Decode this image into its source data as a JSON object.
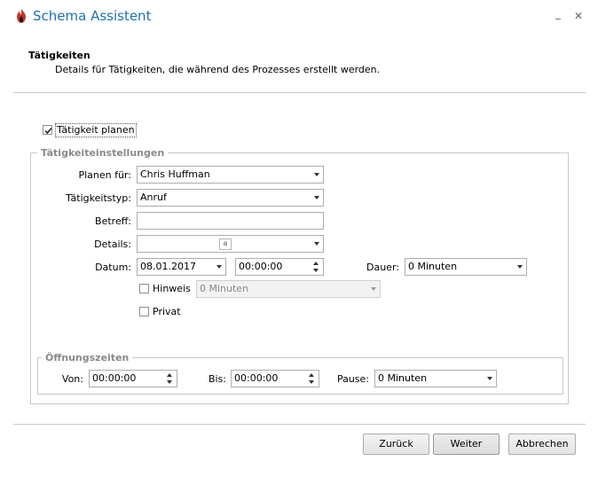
{
  "window": {
    "title": "Schema Assistent",
    "minimize_glyph": "_",
    "close_glyph": "✕",
    "logo_icon": "flame-logo-icon",
    "accent_color": "#1f6fb2"
  },
  "header": {
    "title": "Tätigkeiten",
    "subtitle": "Details für Tätigkeiten, die während des Prozesses erstellt werden."
  },
  "plan_checkbox": {
    "label": "Tätigkeit planen",
    "checked": true
  },
  "settings": {
    "legend": "Tätigkeiteinstellungen",
    "planen_fuer": {
      "label": "Planen für:",
      "value": "Chris Huffman"
    },
    "taetigkeitstyp": {
      "label": "Tätigkeitstyp:",
      "value": "Anruf"
    },
    "betreff": {
      "label": "Betreff:",
      "value": ""
    },
    "details": {
      "label": "Details:",
      "value": "",
      "icon_glyph": "a"
    },
    "datum": {
      "label": "Datum:",
      "date": "08.01.2017",
      "time": "00:00:00"
    },
    "dauer": {
      "label": "Dauer:",
      "value": "0 Minuten"
    },
    "hinweis": {
      "label": "Hinweis",
      "checked": false,
      "value": "0 Minuten"
    },
    "privat": {
      "label": "Privat",
      "checked": false
    }
  },
  "hours": {
    "legend": "Öffnungszeiten",
    "von": {
      "label": "Von:",
      "value": "00:00:00"
    },
    "bis": {
      "label": "Bis:",
      "value": "00:00:00"
    },
    "pause": {
      "label": "Pause:",
      "value": "0 Minuten"
    }
  },
  "buttons": {
    "back": "Zurück",
    "next": "Weiter",
    "cancel": "Abbrechen"
  }
}
